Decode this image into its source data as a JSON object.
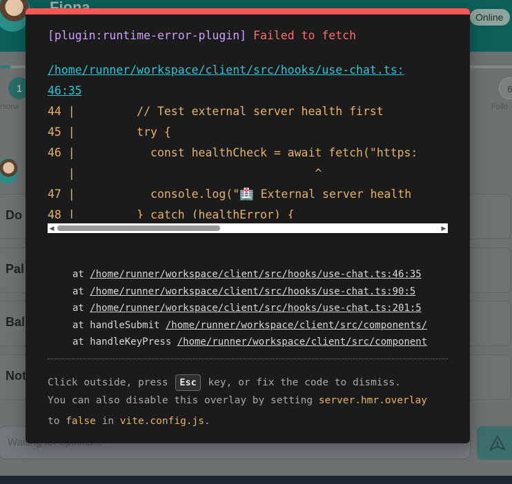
{
  "background_app": {
    "header_name": "Fiona",
    "online_badge": "Online",
    "progress_fraction": 0.02,
    "step_1": "1",
    "step_1_label": "ersona",
    "step_6": "6",
    "step_6_label": "Follo",
    "options": [
      "Do",
      "Pal",
      "Bal",
      "Not"
    ],
    "input_placeholder": "Waiting for options...",
    "accent_color": "#0d5f5a",
    "icons": {
      "send": "send-icon"
    }
  },
  "overlay": {
    "plugin_tag": "[plugin:runtime-error-plugin]",
    "message": "Failed to fetch",
    "file_link_line1": "/home/runner/workspace/client/src/hooks/use-chat.ts:",
    "file_link_line2": "46:35",
    "code_frame": [
      "44 |         // Test external server health first",
      "45 |         try {",
      "46 |           const healthCheck = await fetch(\"https:",
      "   |                                   ^",
      "47 |           console.log(\"🏥 External server health",
      "48 |         } catch (healthError) {"
    ],
    "stack": [
      {
        "prefix": "at ",
        "path": "/home/runner/workspace/client/src/hooks/use-chat.ts:46:35"
      },
      {
        "prefix": "at ",
        "path": "/home/runner/workspace/client/src/hooks/use-chat.ts:90:5"
      },
      {
        "prefix": "at ",
        "path": "/home/runner/workspace/client/src/hooks/use-chat.ts:201:5"
      },
      {
        "prefix": "at handleSubmit ",
        "path": "/home/runner/workspace/client/src/components/"
      },
      {
        "prefix": "at handleKeyPress ",
        "path": "/home/runner/workspace/client/src/component"
      }
    ],
    "tip": {
      "before_key": "Click outside, press ",
      "key": "Esc",
      "after_key": " key, or fix the code to dismiss.",
      "line2_text": "You can also disable this overlay by setting ",
      "line2_code": "server.hmr.overlay",
      "line3_code1": "false",
      "line3_mid": " in ",
      "line3_code2": "vite.config.js",
      "line3_end": ".",
      "line3_to": "to "
    },
    "colors": {
      "top_bar": "#ff5555",
      "plugin": "#cfa0ff",
      "message": "#ff6e6e",
      "link": "#2fc4d6",
      "code": "#e6b36c"
    }
  }
}
